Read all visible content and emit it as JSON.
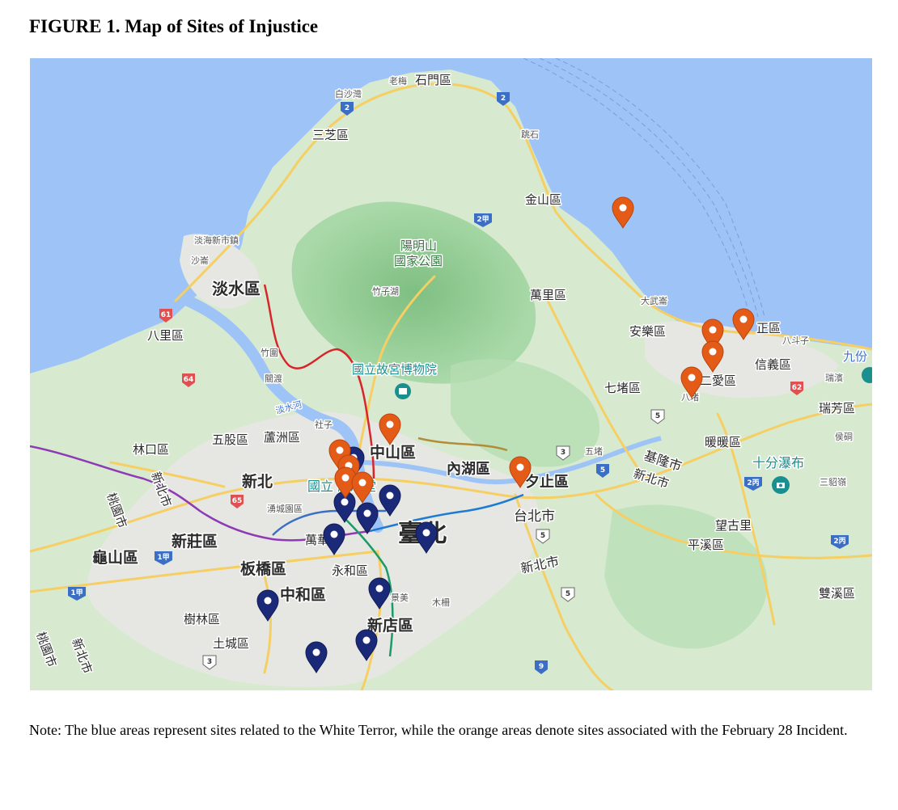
{
  "figure": {
    "title": "FIGURE 1. Map of Sites of Injustice",
    "note": "Note:  The blue areas represent sites related to the White Terror, while the orange areas denote sites associated with the February 28 Incident."
  },
  "map": {
    "labels": {
      "baishawan": "白沙灣",
      "laomei": "老梅",
      "shimen": "石門區",
      "sanzhi": "三芝區",
      "tiaoshi": "跳石",
      "jinshan": "金山區",
      "danhai_newtown": "淡海新市鎮",
      "shalun": "沙崙",
      "yangmingshan": "陽明山",
      "national_park": "國家公園",
      "zhuzihu": "竹子湖",
      "tamsui": "淡水區",
      "wanli": "萬里區",
      "dawuluan": "大武崙",
      "anle": "安樂區",
      "zhongzheng": "正區",
      "badouzi": "八斗子",
      "bali": "八里區",
      "zhuwei": "竹圍",
      "guandu": "關渡",
      "palace_museum": "國立故宮博物院",
      "xinyi": "信義區",
      "ruibin": "瑞濱",
      "qidu": "七堵區",
      "ren_ai": "二愛區",
      "nuannuan_label": "八堵",
      "ruifang": "瑞芳區",
      "jiufen": "九份",
      "tamsui_river": "淡水河",
      "shezi": "社子",
      "linkou": "林口區",
      "wugu": "五股區",
      "luzhou": "蘆洲區",
      "zhongshan": "中山區",
      "neihu": "內湖區",
      "xizhi": "夕止區",
      "wudu": "五堵",
      "keelung_city": "基隆市",
      "nuannuan": "暖暖區",
      "houtong": "侯硐",
      "shifen": "十分瀑布",
      "sandiaoling": "三貂嶺",
      "new_taipei_top": "新北",
      "memorial": "國立  紀念堂",
      "new_taipei_city_e": "新北市",
      "taoyuan_city": "桃園市",
      "new_taipei_city_w": "新北市",
      "xinzhuang": "新莊區",
      "huacheng": "湧城園區",
      "wanhua": "萬華",
      "taipei": "臺北",
      "taipei_city": "台北市",
      "wanggu": "望古里",
      "pingxi": "平溪區",
      "guishan": "龜山區",
      "banqiao": "板橋區",
      "yonghe": "永和區",
      "new_taipei_city_s": "新北市",
      "zhonghe": "中和區",
      "jingmei": "景美",
      "muzha": "木柵",
      "shuanxi": "雙溪區",
      "shulin": "樹林區",
      "xindian": "新店區",
      "tucheng": "土城區",
      "taoyuan_city_sw": "桃園市",
      "new_taipei_city_sw": "新北市"
    },
    "shields": [
      "2",
      "2",
      "2甲",
      "61",
      "64",
      "65",
      "1甲",
      "1甲",
      "62",
      "2丙",
      "2丙",
      "3",
      "5",
      "9",
      "3",
      "5",
      "5",
      "5"
    ],
    "colors": {
      "water": "#9ec3f7",
      "land": "#d7ead0",
      "park": "#a9d9a8",
      "urban": "#e8e8e4",
      "road": "#f5cf63",
      "white_terror_marker": "#1b2a78",
      "feb28_marker": "#e35b16"
    },
    "legend_semantics": {
      "blue": "White Terror",
      "orange": "February 28 Incident"
    }
  }
}
